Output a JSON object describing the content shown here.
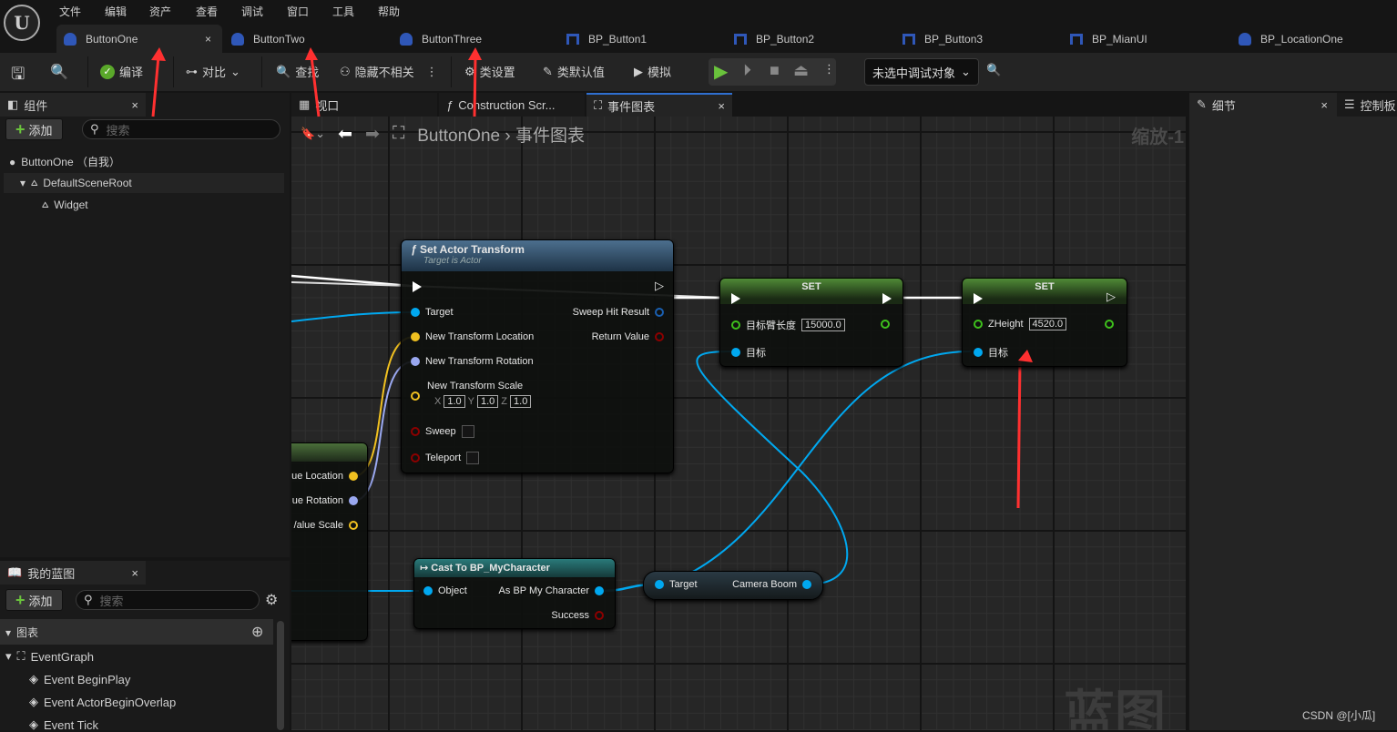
{
  "menu": [
    "文件",
    "编辑",
    "资产",
    "查看",
    "调试",
    "窗口",
    "工具",
    "帮助"
  ],
  "tabs": [
    {
      "label": "ButtonOne",
      "type": "actor"
    },
    {
      "label": "ButtonTwo",
      "type": "actor"
    },
    {
      "label": "ButtonThree",
      "type": "actor"
    },
    {
      "label": "BP_Button1",
      "type": "widget"
    },
    {
      "label": "BP_Button2",
      "type": "widget"
    },
    {
      "label": "BP_Button3",
      "type": "widget"
    },
    {
      "label": "BP_MianUI",
      "type": "widget"
    },
    {
      "label": "BP_LocationOne",
      "type": "actor"
    }
  ],
  "toolbar": {
    "compile": "编译",
    "diff": "对比",
    "find": "查找",
    "hide_unrelated": "隐藏不相关",
    "class_settings": "类设置",
    "class_defaults": "类默认值",
    "simulate": "模拟",
    "debug_target": "未选中调试对象"
  },
  "components": {
    "title": "组件",
    "add": "添加",
    "search_placeholder": "搜索",
    "items": [
      "ButtonOne （自我）",
      "DefaultSceneRoot",
      "Widget"
    ]
  },
  "my_blueprint": {
    "title": "我的蓝图",
    "add": "添加",
    "search_placeholder": "搜索",
    "section": "图表",
    "graph": "EventGraph",
    "events": [
      "Event BeginPlay",
      "Event ActorBeginOverlap",
      "Event Tick"
    ]
  },
  "editor_tabs": {
    "viewport": "视口",
    "construction": "Construction Scr...",
    "event_graph": "事件图表"
  },
  "breadcrumb": {
    "root": "ButtonOne",
    "sep": "›",
    "current": "事件图表",
    "zoom": "缩放-1"
  },
  "nodes": {
    "set_actor_transform": {
      "title": "Set Actor Transform",
      "subtitle": "Target is Actor",
      "inputs": [
        "Target",
        "New Transform Location",
        "New Transform Rotation",
        "New Transform Scale",
        "Sweep",
        "Teleport"
      ],
      "outputs": [
        "Sweep Hit Result",
        "Return Value"
      ],
      "scale": {
        "x": "1.0",
        "y": "1.0",
        "z": "1.0"
      },
      "axes": [
        "X",
        "Y",
        "Z"
      ]
    },
    "set1": {
      "title": "SET",
      "var": "目标臂长度",
      "value": "15000.0",
      "target": "目标"
    },
    "set2": {
      "title": "SET",
      "var": "ZHeight",
      "value": "4520.0",
      "target": "目标"
    },
    "cast": {
      "title": "Cast To BP_MyCharacter",
      "input": "Object",
      "outputs": [
        "As BP My Character",
        "Success"
      ]
    },
    "getter": {
      "input": "Target",
      "output": "Camera Boom"
    },
    "partial": {
      "outputs": [
        "ue Location",
        "ue Rotation",
        "/alue Scale"
      ]
    }
  },
  "details": {
    "title": "细节",
    "control": "控制板"
  },
  "watermark": "蓝图",
  "credit": "CSDN @[小瓜]",
  "colors": {
    "exec": "#ffffff",
    "object": "#00a8f0",
    "vector": "#f0c020",
    "rotator": "#9aa8f0",
    "float": "#3ec01c",
    "bool": "#8c0000",
    "annotation_arrow": "#ff3030"
  }
}
